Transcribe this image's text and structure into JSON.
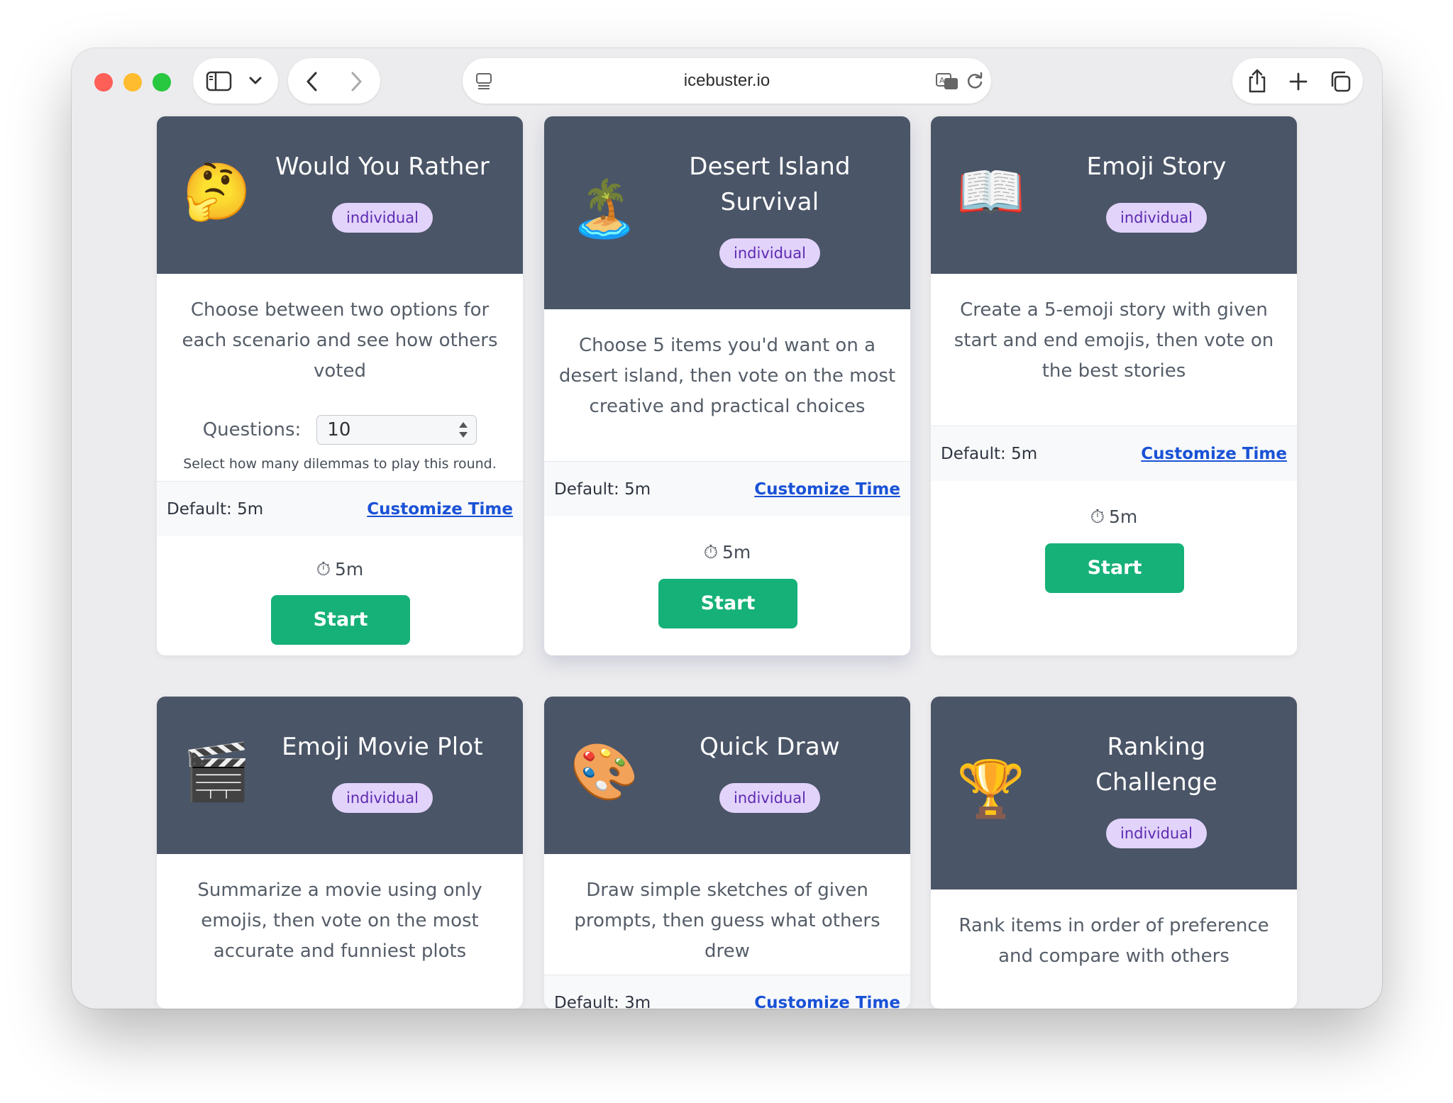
{
  "browser": {
    "url": "icebuster.io",
    "icons": [
      "sidebar-icon",
      "chevron-down-icon",
      "back-icon",
      "forward-icon",
      "page-menu-icon",
      "translate-icon",
      "reload-icon",
      "share-icon",
      "new-tab-icon",
      "tabs-overview-icon"
    ]
  },
  "colors": {
    "card_header": "#4a5567",
    "badge_bg": "#e2d3fb",
    "badge_text": "#5d2bb0",
    "start_button": "#16b178",
    "link": "#1a52d6"
  },
  "cards": [
    {
      "emoji": "🤔",
      "title_lines": [
        "Would You Rather"
      ],
      "badge": "individual",
      "description": "Choose between two options for each scenario and see how others voted",
      "setting_label": "Questions:",
      "setting_value": "10",
      "setting_hint": "Select how many dilemmas to play this round.",
      "default_time": "Default: 5m",
      "customize_label": "Customize Time",
      "timer": "5m",
      "start_label": "Start"
    },
    {
      "emoji": "🏝️",
      "title_lines": [
        "Desert Island",
        "Survival"
      ],
      "badge": "individual",
      "description": "Choose 5 items you'd want on a desert island, then vote on the most creative and practical choices",
      "default_time": "Default: 5m",
      "customize_label": "Customize Time",
      "timer": "5m",
      "start_label": "Start"
    },
    {
      "emoji": "📖",
      "title_lines": [
        "Emoji Story"
      ],
      "badge": "individual",
      "description": "Create a 5-emoji story with given start and end emojis, then vote on the best stories",
      "default_time": "Default: 5m",
      "customize_label": "Customize Time",
      "timer": "5m",
      "start_label": "Start"
    },
    {
      "emoji": "🎬",
      "title_lines": [
        "Emoji Movie Plot"
      ],
      "badge": "individual",
      "description": "Summarize a movie using only emojis, then vote on the most accurate and funniest plots"
    },
    {
      "emoji": "🎨",
      "title_lines": [
        "Quick Draw"
      ],
      "badge": "individual",
      "description": "Draw simple sketches of given prompts, then guess what others drew",
      "default_time": "Default: 3m",
      "customize_label": "Customize Time"
    },
    {
      "emoji": "🏆",
      "title_lines": [
        "Ranking",
        "Challenge"
      ],
      "badge": "individual",
      "description": "Rank items in order of preference and compare with others"
    }
  ]
}
